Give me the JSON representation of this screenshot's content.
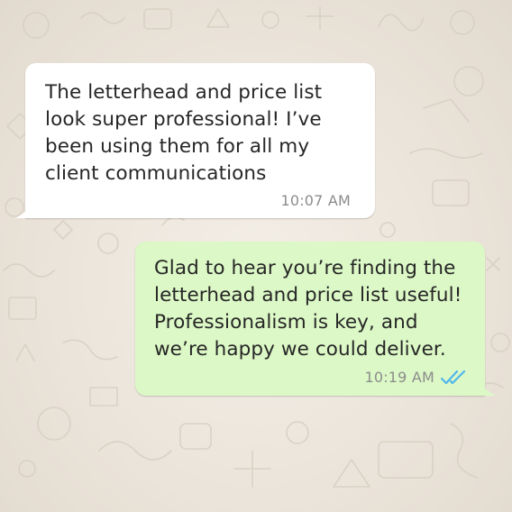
{
  "conversation": {
    "messages": [
      {
        "direction": "incoming",
        "text": "The letterhead and price list\nlook super professional! I’ve\nbeen using them for all my\nclient communications",
        "time": "10:07 AM"
      },
      {
        "direction": "outgoing",
        "text": "Glad to hear you’re finding the\nletterhead and price list useful!\nProfessionalism is key, and\nwe’re happy we could deliver.",
        "time": "10:19 AM",
        "status_icon": "double-check-read-icon"
      }
    ]
  },
  "colors": {
    "incoming_bubble": "#ffffff",
    "outgoing_bubble": "#dcf8c6",
    "read_receipt": "#4fb6ec",
    "timestamp": "#8c8c8c",
    "wallpaper": "#ebe4da"
  }
}
